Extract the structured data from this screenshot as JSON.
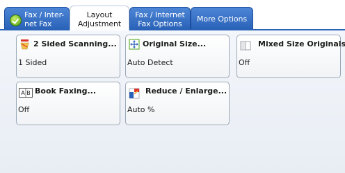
{
  "tabs": [
    {
      "label": "Fax / Inter-\nnet Fax",
      "active": false
    },
    {
      "label": "Layout\nAdjustment",
      "active": true
    },
    {
      "label": "Fax / Internet\nFax Options",
      "active": false
    },
    {
      "label": "More Options",
      "active": false
    }
  ],
  "buttons": [
    {
      "title": "2 Sided Scanning...",
      "value": "1 Sided",
      "icon": "two-sided-icon"
    },
    {
      "title": "Original Size...",
      "value": "Auto Detect",
      "icon": "original-size-icon"
    },
    {
      "title": "Mixed Size Originals...",
      "value": "Off",
      "icon": "mixed-size-icon"
    },
    {
      "title": "Book Faxing...",
      "value": "Off",
      "icon": "book-icon"
    },
    {
      "title": "Reduce / Enlarge...",
      "value": "Auto %",
      "icon": "reduce-enlarge-icon"
    }
  ],
  "colors": {
    "tab_blue": "#2a62b8",
    "panel": "#eef2f7",
    "accent_red": "#d9322a",
    "accent_green": "#48a316"
  },
  "book_icon_text": "A B"
}
